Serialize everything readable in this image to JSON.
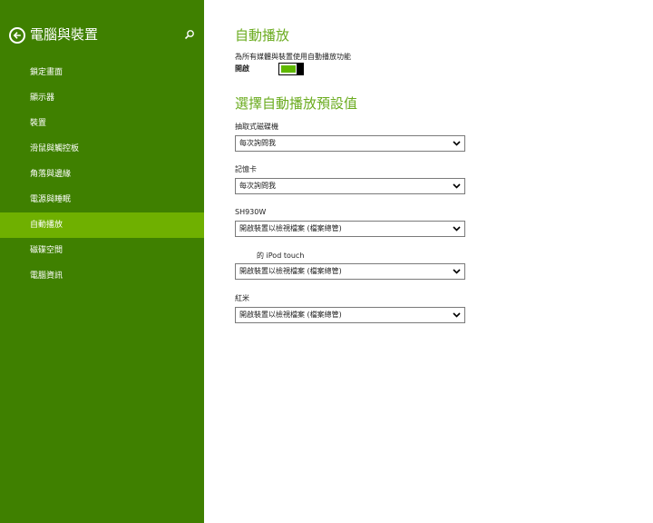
{
  "sidebar": {
    "title": "電腦與裝置",
    "back_icon": "back-arrow-icon",
    "search_icon": "search-icon",
    "items": [
      {
        "label": "鎖定畫面"
      },
      {
        "label": "顯示器"
      },
      {
        "label": "裝置"
      },
      {
        "label": "滑鼠與觸控板"
      },
      {
        "label": "角落與邊緣"
      },
      {
        "label": "電源與睡眠"
      },
      {
        "label": "自動播放"
      },
      {
        "label": "磁碟空間"
      },
      {
        "label": "電腦資訊"
      }
    ],
    "active_item": "自動播放"
  },
  "main": {
    "autoplay_title": "自動播放",
    "autoplay_desc": "為所有媒體與裝置使用自動播放功能",
    "toggle_label": "開啟",
    "toggle_on": true,
    "defaults_title": "選擇自動播放預設值",
    "devices": [
      {
        "label": "抽取式磁碟機",
        "value": "每次詢問我"
      },
      {
        "label": "記憶卡",
        "value": "每次詢問我"
      },
      {
        "label": "SH930W",
        "value": "開啟裝置以檢視檔案 (檔案總管)"
      },
      {
        "label": "的 iPod touch",
        "value": "開啟裝置以檢視檔案 (檔案總管)"
      },
      {
        "label": "紅米",
        "value": "開啟裝置以檢視檔案 (檔案總管)"
      }
    ]
  },
  "colors": {
    "sidebar_bg": "#3f8000",
    "sidebar_active": "#6fb000",
    "accent_heading": "#6aab1e",
    "toggle_fill": "#5fb800"
  }
}
